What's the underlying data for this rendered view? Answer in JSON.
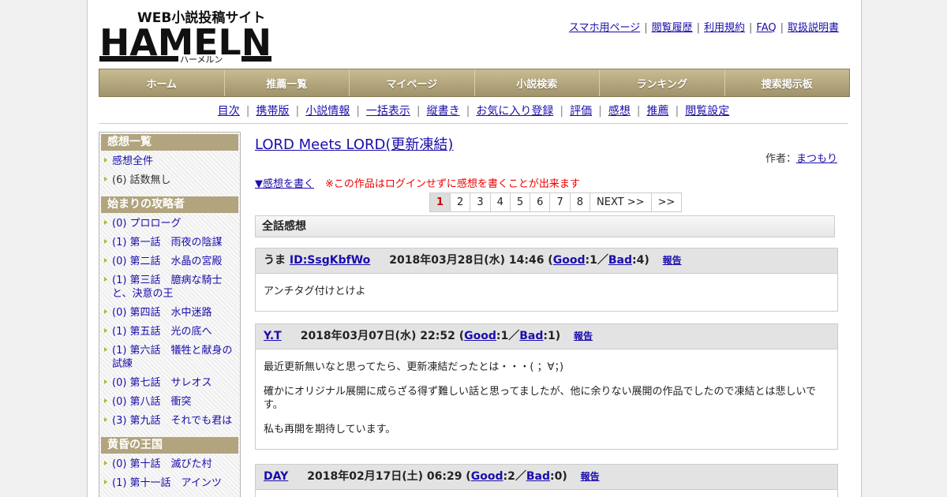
{
  "logo": {
    "line1": "WEB小説投稿サイト",
    "line2": "HAMELN",
    "line3": "ハーメルン"
  },
  "toplinks": [
    "スマホ用ページ",
    "閲覧履歴",
    "利用規約",
    "FAQ",
    "取扱説明書"
  ],
  "mainnav": [
    "ホーム",
    "推薦一覧",
    "マイページ",
    "小説検索",
    "ランキング",
    "捜索掲示板"
  ],
  "subnav": [
    "目次",
    "携帯版",
    "小説情報",
    "一括表示",
    "縦書き",
    "お気に入り登録",
    "評価",
    "感想",
    "推薦",
    "閲覧設定"
  ],
  "sidebar": {
    "sections": [
      {
        "title": "感想一覧",
        "items": [
          {
            "text": "感想全件",
            "link": true
          },
          {
            "text": "(6) 話数無し",
            "link": false
          }
        ]
      },
      {
        "title": "始まりの攻略者",
        "items": [
          {
            "text": "(0) プロローグ",
            "link": true
          },
          {
            "text": "(1) 第一話　雨夜の陰謀",
            "link": true
          },
          {
            "text": "(0) 第二話　水晶の宮殿",
            "link": true
          },
          {
            "text": "(1) 第三話　臆病な騎士と、決意の王",
            "link": true
          },
          {
            "text": "(0) 第四話　水中迷路",
            "link": true
          },
          {
            "text": "(1) 第五話　光の底へ",
            "link": true
          },
          {
            "text": "(1) 第六話　犠牲と献身の試練",
            "link": true
          },
          {
            "text": "(0) 第七話　サレオス",
            "link": true
          },
          {
            "text": "(0) 第八話　衝突",
            "link": true
          },
          {
            "text": "(3) 第九話　それでも君は",
            "link": true
          }
        ]
      },
      {
        "title": "黄昏の王国",
        "items": [
          {
            "text": "(0) 第十話　滅びた村",
            "link": true
          },
          {
            "text": "(1) 第十一話　アインツ",
            "link": true
          }
        ]
      }
    ]
  },
  "main": {
    "title": "LORD Meets LORD(更新凍結)",
    "author_label": "作者：",
    "author": "まつもり",
    "write_link": "▼感想を書く",
    "warning": "※この作品はログインせずに感想を書くことが出来ます",
    "pager": [
      "1",
      "2",
      "3",
      "4",
      "5",
      "6",
      "7",
      "8",
      "NEXT >>",
      ">>"
    ],
    "pager_current": "1",
    "all_header": "全話感想",
    "reviews": [
      {
        "prefix": "うま ",
        "user": "ID:SsgKbfWo",
        "date": "2018年03月28日(水) 14:46",
        "good": "1",
        "bad": "4",
        "report": "報告",
        "body": [
          "アンチタグ付けとけよ"
        ]
      },
      {
        "prefix": "",
        "user": "Y.T",
        "date": "2018年03月07日(水) 22:52",
        "good": "1",
        "bad": "1",
        "report": "報告",
        "body": [
          "最近更新無いなと思ってたら、更新凍結だったとは・・・( ；∀；)",
          "確かにオリジナル展開に成らざる得ず難しい話と思ってましたが、他に余りない展開の作品でしたので凍結とは悲しいです。",
          "私も再開を期待しています。"
        ]
      },
      {
        "prefix": "",
        "user": "DAY",
        "date": "2018年02月17日(土) 06:29",
        "good": "2",
        "bad": "0",
        "report": "報告",
        "body": [
          ""
        ]
      }
    ],
    "good_label": "Good",
    "bad_label": "Bad"
  }
}
